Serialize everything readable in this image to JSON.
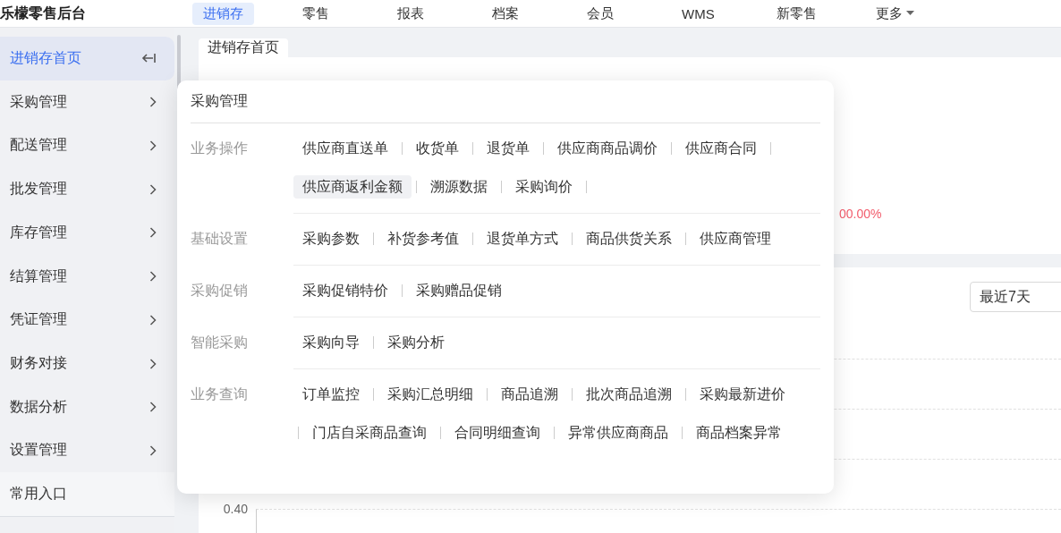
{
  "top_bar": {
    "logo": "乐檬零售后台",
    "nav": [
      {
        "label": "进销存",
        "selected": true
      },
      {
        "label": "零售",
        "selected": false
      },
      {
        "label": "报表",
        "selected": false
      },
      {
        "label": "档案",
        "selected": false
      },
      {
        "label": "会员",
        "selected": false
      },
      {
        "label": "WMS",
        "selected": false
      },
      {
        "label": "新零售",
        "selected": false
      },
      {
        "label": "更多",
        "selected": false,
        "dropdown": true
      }
    ]
  },
  "sidebar": {
    "items": [
      {
        "label": "进销存首页",
        "selected": true
      },
      {
        "label": "采购管理",
        "selected": false
      },
      {
        "label": "配送管理",
        "selected": false
      },
      {
        "label": "批发管理",
        "selected": false
      },
      {
        "label": "库存管理",
        "selected": false
      },
      {
        "label": "结算管理",
        "selected": false
      },
      {
        "label": "凭证管理",
        "selected": false
      },
      {
        "label": "财务对接",
        "selected": false
      },
      {
        "label": "数据分析",
        "selected": false
      },
      {
        "label": "设置管理",
        "selected": false
      }
    ],
    "footer": "常用入口"
  },
  "tabs": [
    {
      "label": "进销存首页",
      "selected": true
    }
  ],
  "summary": {
    "percent": "00.00%"
  },
  "range_select": {
    "value": "最近7天"
  },
  "chart_axis_labels": [
    "0.40"
  ],
  "flyout": {
    "title": "采购管理",
    "sections": [
      {
        "label": "业务操作",
        "items": [
          {
            "label": "供应商直送单",
            "highlighted": false
          },
          {
            "label": "收货单",
            "highlighted": false
          },
          {
            "label": "退货单",
            "highlighted": false
          },
          {
            "label": "供应商商品调价",
            "highlighted": false
          },
          {
            "label": "供应商合同",
            "highlighted": false
          },
          {
            "label": "供应商返利金额",
            "highlighted": true
          },
          {
            "label": "溯源数据",
            "highlighted": false
          },
          {
            "label": "采购询价",
            "highlighted": false
          }
        ]
      },
      {
        "label": "基础设置",
        "items": [
          {
            "label": "采购参数",
            "highlighted": false
          },
          {
            "label": "补货参考值",
            "highlighted": false
          },
          {
            "label": "退货单方式",
            "highlighted": false
          },
          {
            "label": "商品供货关系",
            "highlighted": false
          },
          {
            "label": "供应商管理",
            "highlighted": false
          }
        ]
      },
      {
        "label": "采购促销",
        "items": [
          {
            "label": "采购促销特价",
            "highlighted": false
          },
          {
            "label": "采购赠品促销",
            "highlighted": false
          }
        ]
      },
      {
        "label": "智能采购",
        "items": [
          {
            "label": "采购向导",
            "highlighted": false
          },
          {
            "label": "采购分析",
            "highlighted": false
          }
        ]
      },
      {
        "label": "业务查询",
        "items": [
          {
            "label": "订单监控",
            "highlighted": false
          },
          {
            "label": "采购汇总明细",
            "highlighted": false
          },
          {
            "label": "商品追溯",
            "highlighted": false
          },
          {
            "label": "批次商品追溯",
            "highlighted": false
          },
          {
            "label": "采购最新进价",
            "highlighted": false
          },
          {
            "label": "门店自采商品查询",
            "highlighted": false
          },
          {
            "label": "合同明细查询",
            "highlighted": false
          },
          {
            "label": "异常供应商商品",
            "highlighted": false
          },
          {
            "label": "商品档案异常",
            "highlighted": false
          }
        ]
      }
    ]
  }
}
